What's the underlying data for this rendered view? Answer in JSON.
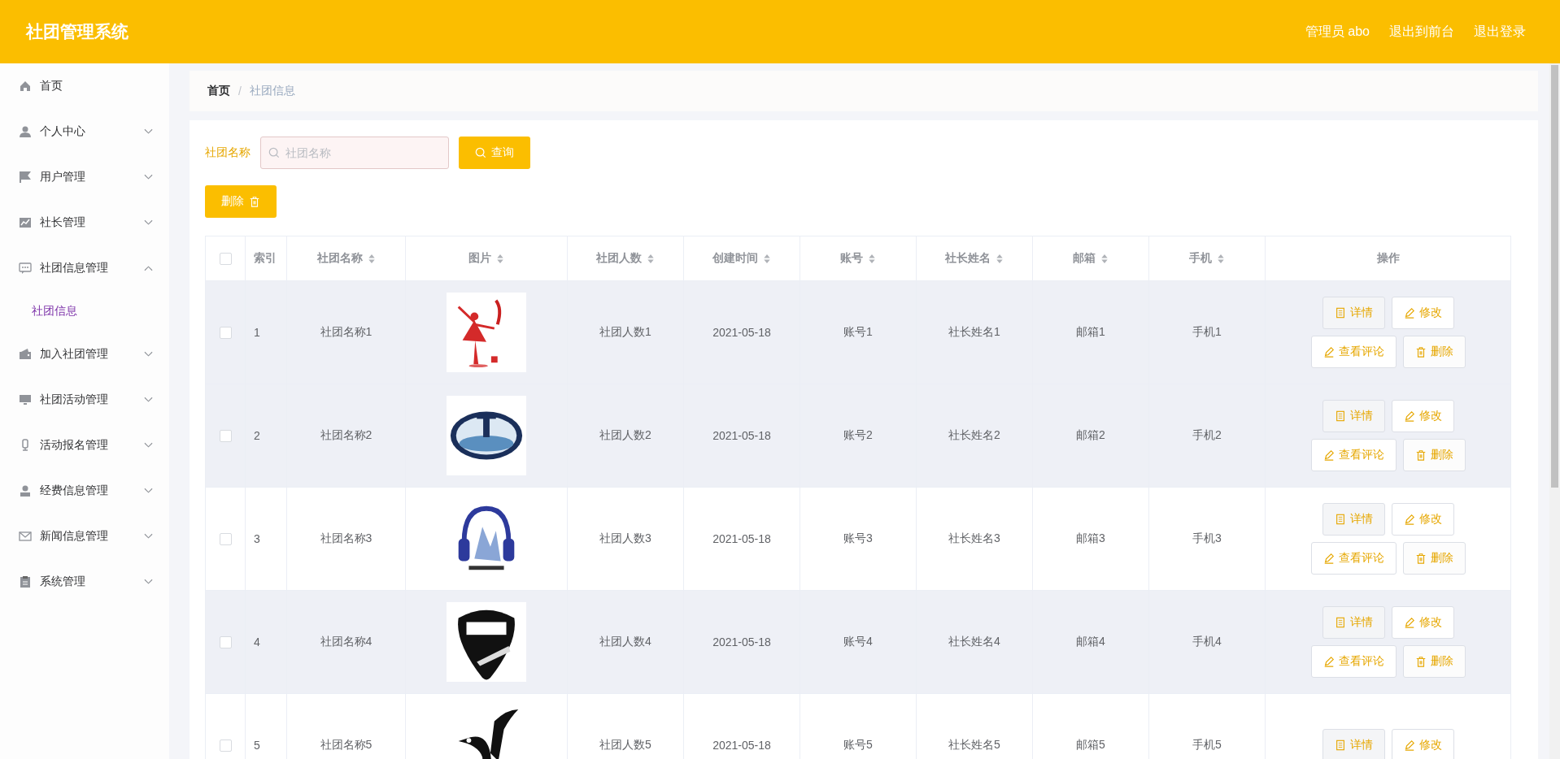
{
  "header": {
    "title": "社团管理系统",
    "links": [
      "管理员 abo",
      "退出到前台",
      "退出登录"
    ]
  },
  "sidebar": {
    "items": [
      {
        "label": "首页"
      },
      {
        "label": "个人中心",
        "expandable": true,
        "expanded": false
      },
      {
        "label": "用户管理",
        "expandable": true,
        "expanded": false
      },
      {
        "label": "社长管理",
        "expandable": true,
        "expanded": false
      },
      {
        "label": "社团信息管理",
        "expandable": true,
        "expanded": true,
        "children": [
          {
            "label": "社团信息",
            "selected": true
          }
        ]
      },
      {
        "label": "加入社团管理",
        "expandable": true,
        "expanded": false
      },
      {
        "label": "社团活动管理",
        "expandable": true,
        "expanded": false
      },
      {
        "label": "活动报名管理",
        "expandable": true,
        "expanded": false
      },
      {
        "label": "经费信息管理",
        "expandable": true,
        "expanded": false
      },
      {
        "label": "新闻信息管理",
        "expandable": true,
        "expanded": false
      },
      {
        "label": "系统管理",
        "expandable": true,
        "expanded": false
      }
    ]
  },
  "breadcrumb": {
    "items": [
      "首页",
      "社团信息"
    ],
    "separator": "/"
  },
  "search": {
    "label": "社团名称",
    "placeholder": "社团名称",
    "button": "查询"
  },
  "delete_button": "删除",
  "table": {
    "all_checked": false,
    "columns": [
      {
        "label": "索引",
        "sortable": false
      },
      {
        "label": "社团名称",
        "sortable": true
      },
      {
        "label": "图片",
        "sortable": true
      },
      {
        "label": "社团人数",
        "sortable": true
      },
      {
        "label": "创建时间",
        "sortable": true
      },
      {
        "label": "账号",
        "sortable": true
      },
      {
        "label": "社长姓名",
        "sortable": true
      },
      {
        "label": "邮箱",
        "sortable": true
      },
      {
        "label": "手机",
        "sortable": true
      },
      {
        "label": "操作",
        "sortable": false
      }
    ],
    "rows": [
      {
        "checked": false,
        "highlighted": true,
        "cells": [
          "1",
          "社团名称1",
          "",
          "社团人数1",
          "2021-05-18",
          "账号1",
          "社长姓名1",
          "邮箱1",
          "手机1"
        ],
        "actions": [
          {
            "kind": "detail",
            "label": "详情"
          },
          {
            "kind": "edit",
            "label": "修改"
          },
          {
            "kind": "comment",
            "label": "查看评论"
          },
          {
            "kind": "delete",
            "label": "删除"
          }
        ]
      },
      {
        "checked": false,
        "highlighted": true,
        "cells": [
          "2",
          "社团名称2",
          "",
          "社团人数2",
          "2021-05-18",
          "账号2",
          "社长姓名2",
          "邮箱2",
          "手机2"
        ],
        "actions": [
          {
            "kind": "detail",
            "label": "详情"
          },
          {
            "kind": "edit",
            "label": "修改"
          },
          {
            "kind": "comment",
            "label": "查看评论"
          },
          {
            "kind": "delete",
            "label": "删除"
          }
        ]
      },
      {
        "checked": false,
        "highlighted": false,
        "cells": [
          "3",
          "社团名称3",
          "",
          "社团人数3",
          "2021-05-18",
          "账号3",
          "社长姓名3",
          "邮箱3",
          "手机3"
        ],
        "actions": [
          {
            "kind": "detail",
            "label": "详情"
          },
          {
            "kind": "edit",
            "label": "修改"
          },
          {
            "kind": "comment",
            "label": "查看评论"
          },
          {
            "kind": "delete",
            "label": "删除"
          }
        ]
      },
      {
        "checked": false,
        "highlighted": true,
        "cells": [
          "4",
          "社团名称4",
          "",
          "社团人数4",
          "2021-05-18",
          "账号4",
          "社长姓名4",
          "邮箱4",
          "手机4"
        ],
        "actions": [
          {
            "kind": "detail",
            "label": "详情"
          },
          {
            "kind": "edit",
            "label": "修改"
          },
          {
            "kind": "comment",
            "label": "查看评论"
          },
          {
            "kind": "delete",
            "label": "删除"
          }
        ]
      },
      {
        "checked": false,
        "highlighted": false,
        "cells": [
          "5",
          "社团名称5",
          "",
          "社团人数5",
          "2021-05-18",
          "账号5",
          "社长姓名5",
          "邮箱5",
          "手机5"
        ],
        "actions": [
          {
            "kind": "detail",
            "label": "详情"
          },
          {
            "kind": "edit",
            "label": "修改"
          }
        ]
      }
    ]
  }
}
